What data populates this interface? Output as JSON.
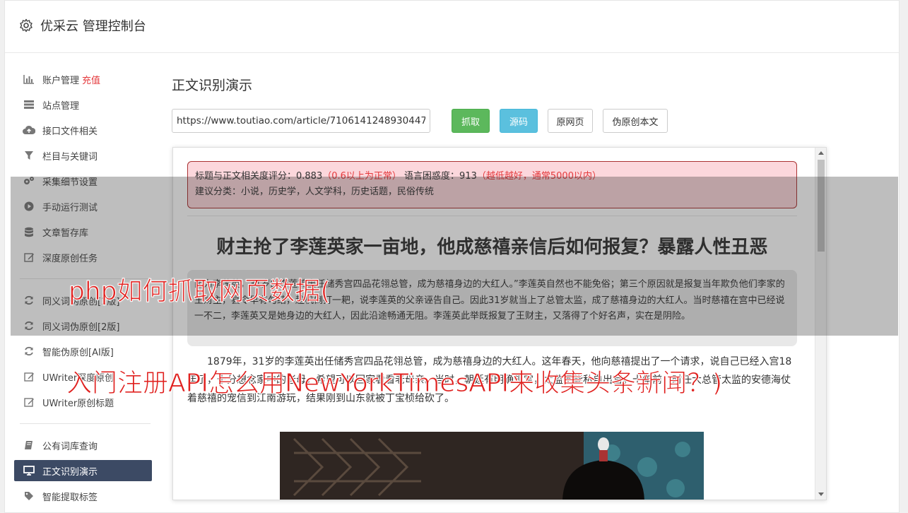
{
  "brand": {
    "title": "优采云 管理控制台"
  },
  "sidebar": {
    "group1": [
      {
        "label": "账户管理",
        "badge": "充值",
        "icon": "bar-chart-icon"
      },
      {
        "label": "站点管理",
        "icon": "server-icon"
      },
      {
        "label": "接口文件相关",
        "icon": "cloud-upload-icon"
      },
      {
        "label": "栏目与关键词",
        "icon": "filter-icon"
      },
      {
        "label": "采集细节设置",
        "icon": "gears-icon"
      },
      {
        "label": "手动运行测试",
        "icon": "play-circle-icon"
      },
      {
        "label": "文章暂存库",
        "icon": "database-icon"
      },
      {
        "label": "深度原创任务",
        "icon": "edit-icon"
      }
    ],
    "group2": [
      {
        "label": "同义词伪原创[1版]",
        "icon": "refresh-icon"
      },
      {
        "label": "同义词伪原创[2版]",
        "icon": "refresh-icon"
      },
      {
        "label": "智能伪原创[AI版]",
        "icon": "refresh-icon"
      },
      {
        "label": "UWriter深度原创",
        "icon": "edit-icon"
      },
      {
        "label": "UWriter原创标题",
        "icon": "edit-icon"
      }
    ],
    "group3": [
      {
        "label": "公有词库查询",
        "icon": "book-icon"
      },
      {
        "label": "正文识别演示",
        "icon": "monitor-icon"
      },
      {
        "label": "智能提取标签",
        "icon": "tag-icon"
      },
      {
        "label": "",
        "icon": "tag-icon"
      }
    ]
  },
  "main": {
    "title": "正文识别演示",
    "url_value": "https://www.toutiao.com/article/7106141248930447",
    "buttons": {
      "fetch": "抓取",
      "source": "源码",
      "original": "原网页",
      "fake_original": "伪原创本文"
    }
  },
  "preview": {
    "alert_line1_a": "标题与正文相关度评分：0.883",
    "alert_line1_b": "（0.6以上为正常）",
    "alert_line1_c": "语言困惑度：913",
    "alert_line1_d": "（越低越好，通常5000以内）",
    "alert_line2": "建议分类：小说，历史学，人文学科，历史话题，民俗传统",
    "article_title": "财主抢了李莲英家一亩地，他成慈禧亲信后如何报复？暴露人性丑恶",
    "summary": "因为李莲英，31岁的李莲英出任储秀宫四品花翎总管，成为慈禧身边的大红人。”李莲英自然也不能免俗；第三个原因就是报复当年欺负他们李家的王财主，县令早有勾结，趁机倒打一耙，说李莲英的父亲诬告自己。因此31岁就当上了总管太监，成了慈禧身边的大红人。当时慈禧在宫中已经说一不二，李莲英又是她身边的大红人，因此沿途畅通无阻。李莲英此举既报复了王财主，又落得了个好名声，实在是阴险。",
    "paragraph": "1879年，31岁的李莲英出任储秀宫四品花翎总管，成为慈禧身边的大红人。这年春天，他向慈禧提出了一个请求，说自己已经入宫18年了，十分想念家中的老母，希望可以回家看看老母亲。当时，朝廷有明确规定，太监不能私自出宫。十年前，时任大总管太监的安德海仗着慈禧的宠信到江南游玩，结果刚到山东就被丁宝桢给砍了。"
  },
  "overlay": {
    "caption_line1": "php如何抓取网页数据(",
    "caption_line2": "入门注册API怎么用NewYorkTimesAPI来收集头条新闻？)"
  },
  "colors": {
    "active_nav": "#3c4a64",
    "fetch_green": "#5cb85c",
    "source_blue": "#5bc0de",
    "alert_red": "#e4393c",
    "caption_red": "#e0211f"
  }
}
